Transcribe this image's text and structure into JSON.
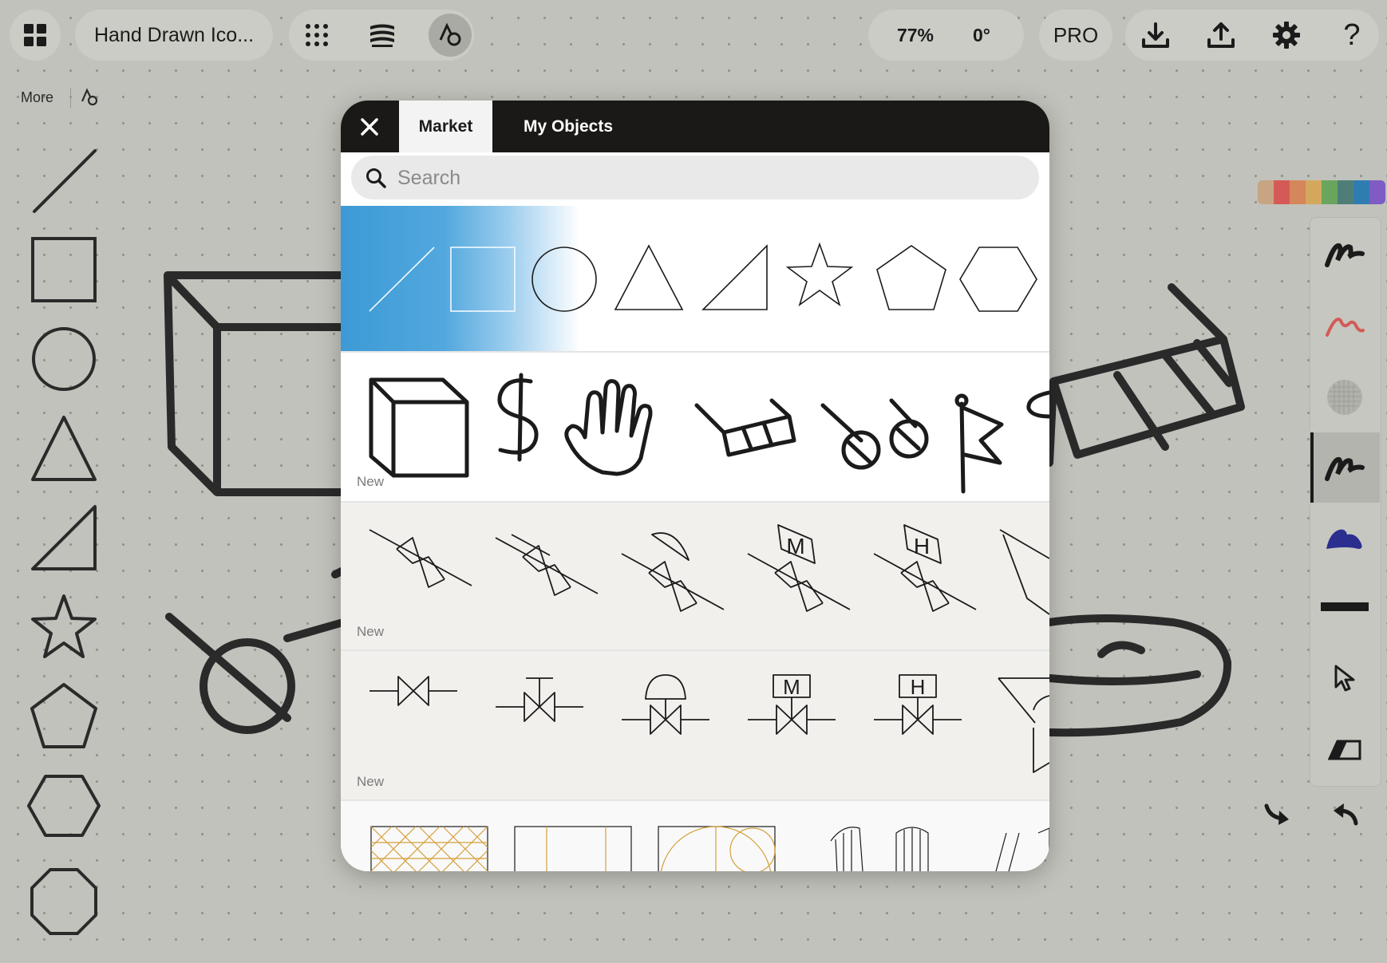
{
  "toolbar": {
    "document_title": "Hand Drawn Ico...",
    "zoom": "77%",
    "rotation": "0°",
    "pro_label": "PRO"
  },
  "left_panel": {
    "more_label": "More"
  },
  "modal": {
    "tabs": [
      {
        "label": "Market",
        "active": true
      },
      {
        "label": "My Objects",
        "active": false
      }
    ],
    "search_placeholder": "Search",
    "new_badge": "New",
    "valve_letters": {
      "m": "M",
      "h": "H"
    },
    "coin_symbol": "$"
  },
  "palette_colors": [
    "#c7a583",
    "#d45a57",
    "#d5875b",
    "#d4a85c",
    "#6aa55d",
    "#4f7e78",
    "#2f7db0",
    "#7f5bc4"
  ],
  "accent": "#3d9ad6",
  "icons": [
    "grid-icon",
    "dots-grid-icon",
    "layers-icon",
    "shapes-icon",
    "download-icon",
    "upload-icon",
    "gear-icon",
    "help-icon",
    "close-icon",
    "search-icon",
    "cursor-icon",
    "eraser-icon",
    "redo-icon",
    "undo-icon"
  ]
}
